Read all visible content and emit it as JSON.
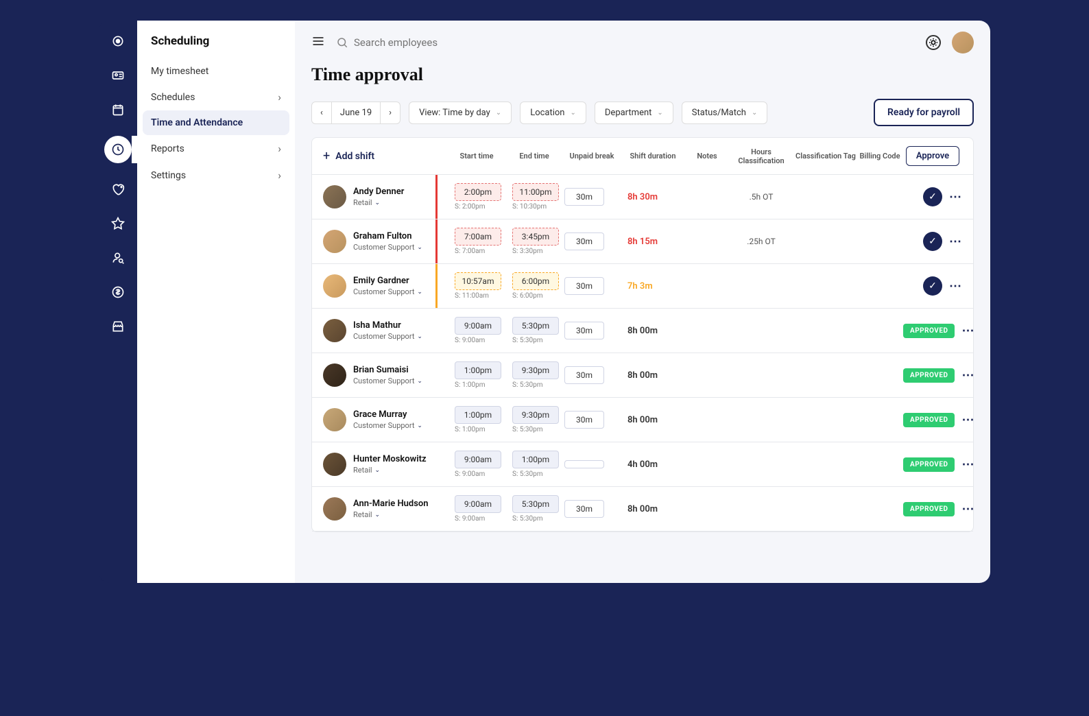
{
  "sidebar": {
    "title": "Scheduling",
    "items": [
      {
        "label": "My timesheet",
        "expandable": false
      },
      {
        "label": "Schedules",
        "expandable": true
      },
      {
        "label": "Time and Attendance",
        "expandable": false,
        "active": true
      },
      {
        "label": "Reports",
        "expandable": true
      },
      {
        "label": "Settings",
        "expandable": true
      }
    ]
  },
  "search": {
    "placeholder": "Search employees"
  },
  "page": {
    "title": "Time approval"
  },
  "toolbar": {
    "date": "June 19",
    "view": "View: Time by day",
    "location": "Location",
    "department": "Department",
    "status": "Status/Match",
    "payroll": "Ready for payroll"
  },
  "table": {
    "add_shift": "Add shift",
    "headers": {
      "start": "Start time",
      "end": "End time",
      "break": "Unpaid break",
      "duration": "Shift duration",
      "notes": "Notes",
      "hours_class": "Hours Classification",
      "class_tag": "Classification Tag",
      "billing": "Billing Code",
      "approve": "Approve"
    },
    "approved_label": "APPROVED",
    "rows": [
      {
        "name": "Andy Denner",
        "dept": "Retail",
        "start": "2:00pm",
        "s_start": "S: 2:00pm",
        "end": "11:00pm",
        "s_end": "S: 10:30pm",
        "break": "30m",
        "dur": "8h 30m",
        "dur_class": "red",
        "hcls": ".5h OT",
        "status": "pending",
        "flag": "red",
        "av": "av1",
        "box": "red"
      },
      {
        "name": "Graham Fulton",
        "dept": "Customer Support",
        "start": "7:00am",
        "s_start": "S: 7:00am",
        "end": "3:45pm",
        "s_end": "S: 3:30pm",
        "break": "30m",
        "dur": "8h 15m",
        "dur_class": "red",
        "hcls": ".25h OT",
        "status": "pending",
        "flag": "red",
        "av": "av2",
        "box": "red"
      },
      {
        "name": "Emily Gardner",
        "dept": "Customer Support",
        "start": "10:57am",
        "s_start": "S: 11:00am",
        "end": "6:00pm",
        "s_end": "S: 6:00pm",
        "break": "30m",
        "dur": "7h 3m",
        "dur_class": "yellow",
        "hcls": "",
        "status": "pending",
        "flag": "yellow",
        "av": "av3",
        "box": "yellow"
      },
      {
        "name": "Isha Mathur",
        "dept": "Customer Support",
        "start": "9:00am",
        "s_start": "S: 9:00am",
        "end": "5:30pm",
        "s_end": "S: 5:30pm",
        "break": "30m",
        "dur": "8h 00m",
        "dur_class": "",
        "hcls": "",
        "status": "approved",
        "flag": "",
        "av": "av4",
        "box": ""
      },
      {
        "name": "Brian Sumaisi",
        "dept": "Customer Support",
        "start": "1:00pm",
        "s_start": "S: 1:00pm",
        "end": "9:30pm",
        "s_end": "S: 5:30pm",
        "break": "30m",
        "dur": "8h 00m",
        "dur_class": "",
        "hcls": "",
        "status": "approved",
        "flag": "",
        "av": "av5",
        "box": ""
      },
      {
        "name": "Grace Murray",
        "dept": "Customer Support",
        "start": "1:00pm",
        "s_start": "S: 1:00pm",
        "end": "9:30pm",
        "s_end": "S: 5:30pm",
        "break": "30m",
        "dur": "8h 00m",
        "dur_class": "",
        "hcls": "",
        "status": "approved",
        "flag": "",
        "av": "av6",
        "box": ""
      },
      {
        "name": "Hunter Moskowitz",
        "dept": "Retail",
        "start": "9:00am",
        "s_start": "S: 9:00am",
        "end": "1:00pm",
        "s_end": "S: 5:30pm",
        "break": "",
        "dur": "4h 00m",
        "dur_class": "",
        "hcls": "",
        "status": "approved",
        "flag": "",
        "av": "av7",
        "box": ""
      },
      {
        "name": "Ann-Marie Hudson",
        "dept": "Retail",
        "start": "9:00am",
        "s_start": "S: 9:00am",
        "end": "5:30pm",
        "s_end": "S: 5:30pm",
        "break": "30m",
        "dur": "8h 00m",
        "dur_class": "",
        "hcls": "",
        "status": "approved",
        "flag": "",
        "av": "av8",
        "box": ""
      }
    ]
  }
}
